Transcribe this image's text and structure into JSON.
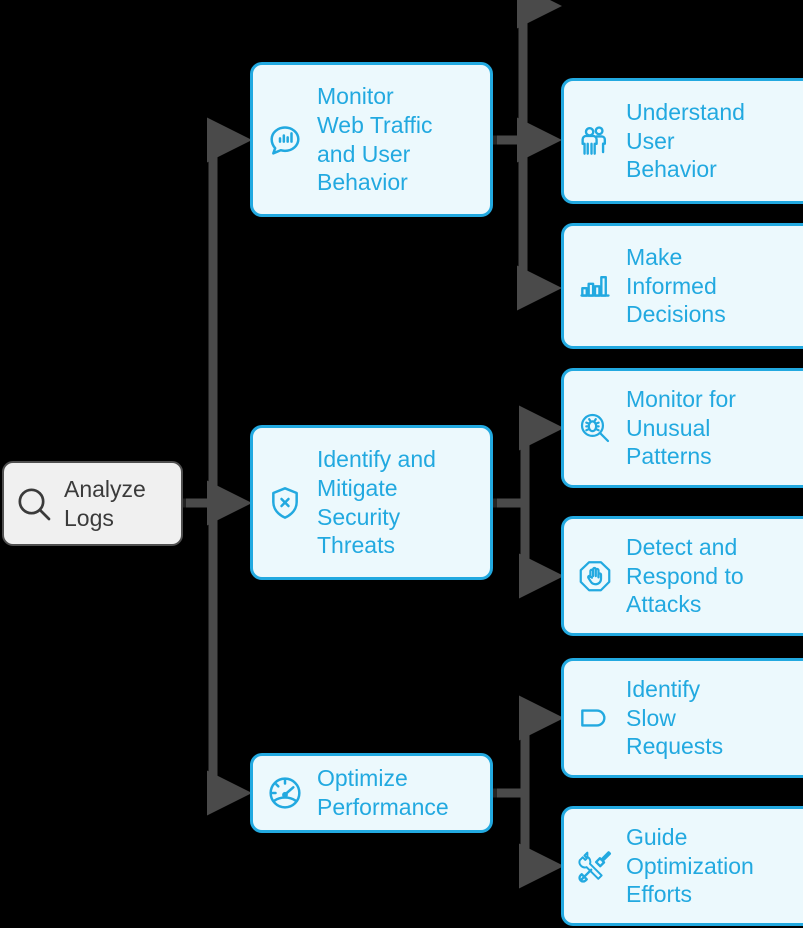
{
  "diagram": {
    "type": "mind-map",
    "title": "Analyze Logs",
    "colors": {
      "background": "#000000",
      "accent": "#22a9e0",
      "node_fill": "#ecf9fd",
      "root_fill": "#f0f0f0",
      "root_stroke": "#4f4f4f",
      "connector": "#4a4a4a"
    },
    "root": {
      "label": "Analyze\nLogs",
      "icon": "magnifier-icon"
    },
    "branches": [
      {
        "label": "Monitor\nWeb Traffic\nand User\nBehavior",
        "icon": "chat-bar-chart-icon",
        "children": [
          {
            "label": "Understand\nUser\nBehavior",
            "icon": "two-people-icon"
          },
          {
            "label": "Make\nInformed\nDecisions",
            "icon": "bar-chart-icon"
          }
        ]
      },
      {
        "label": "Identify and\nMitigate\nSecurity\nThreats",
        "icon": "shield-x-icon",
        "children": [
          {
            "label": "Monitor for\nUnusual\nPatterns",
            "icon": "bug-magnifier-icon"
          },
          {
            "label": "Detect and\nRespond to\nAttacks",
            "icon": "stop-hand-icon"
          }
        ]
      },
      {
        "label": "Optimize\nPerformance",
        "icon": "speedometer-icon",
        "children": [
          {
            "label": "Identify\nSlow\nRequests",
            "icon": "tag-shape-icon"
          },
          {
            "label": "Guide\nOptimization\nEfforts",
            "icon": "tools-icon"
          }
        ]
      }
    ]
  }
}
